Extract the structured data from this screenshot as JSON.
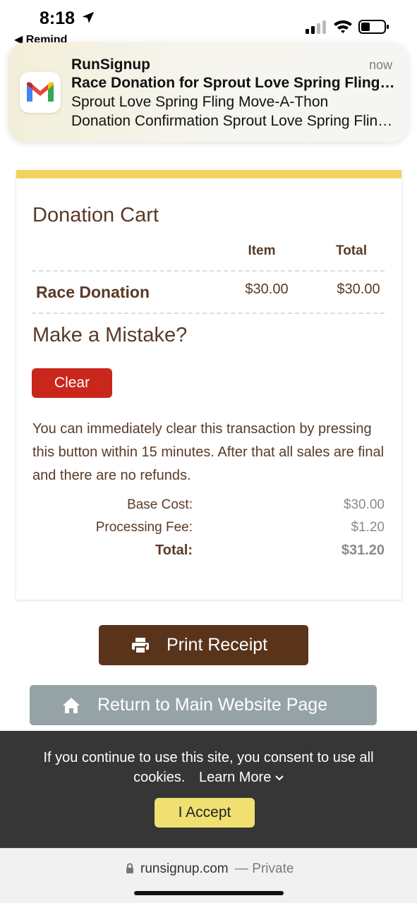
{
  "status_bar": {
    "time": "8:18",
    "back_app": "◀ Remind",
    "icons": [
      "location-arrow-icon",
      "cellular-signal-icon",
      "wifi-icon",
      "battery-icon"
    ]
  },
  "notification": {
    "app_icon": "gmail-icon",
    "sender": "RunSignup",
    "time": "now",
    "subject": "Race Donation for Sprout Love Spring Fling Move-A-Thon",
    "preview_line1": "Sprout Love Spring Fling Move-A-Thon",
    "preview_line2": "Donation Confirmation Sprout Love Spring Fling Move-A-Thon"
  },
  "cart": {
    "title": "Donation Cart",
    "columns": {
      "item": "Item",
      "total": "Total"
    },
    "rows": [
      {
        "name": "Race Donation",
        "item": "$30.00",
        "total": "$30.00"
      }
    ],
    "mistake_heading": "Make a Mistake?",
    "clear_label": "Clear",
    "clear_text": "You can immediately clear this transaction by pressing this button within 15 minutes. After that all sales are final and there are no refunds.",
    "summary": [
      {
        "label": "Base Cost:",
        "value": "$30.00"
      },
      {
        "label": "Processing Fee:",
        "value": "$1.20"
      },
      {
        "label": "Total:",
        "value": "$31.20"
      }
    ]
  },
  "actions": {
    "print_label": "Print Receipt",
    "print_icon": "printer-icon",
    "home_label": "Return to Main Website Page",
    "home_icon": "home-icon"
  },
  "cookie": {
    "text": "If you continue to use this site, you consent to use all cookies.",
    "learn_more": "Learn More",
    "accept_label": "I Accept"
  },
  "url_bar": {
    "domain": "runsignup.com",
    "private": "— Private"
  },
  "colors": {
    "accent_yellow": "#f0d35e",
    "brown": "#5a331b",
    "clear_red": "#c9271b",
    "home_gray": "#95a3a6",
    "banner_dark": "#363636",
    "accept_yellow": "#f0e071"
  }
}
